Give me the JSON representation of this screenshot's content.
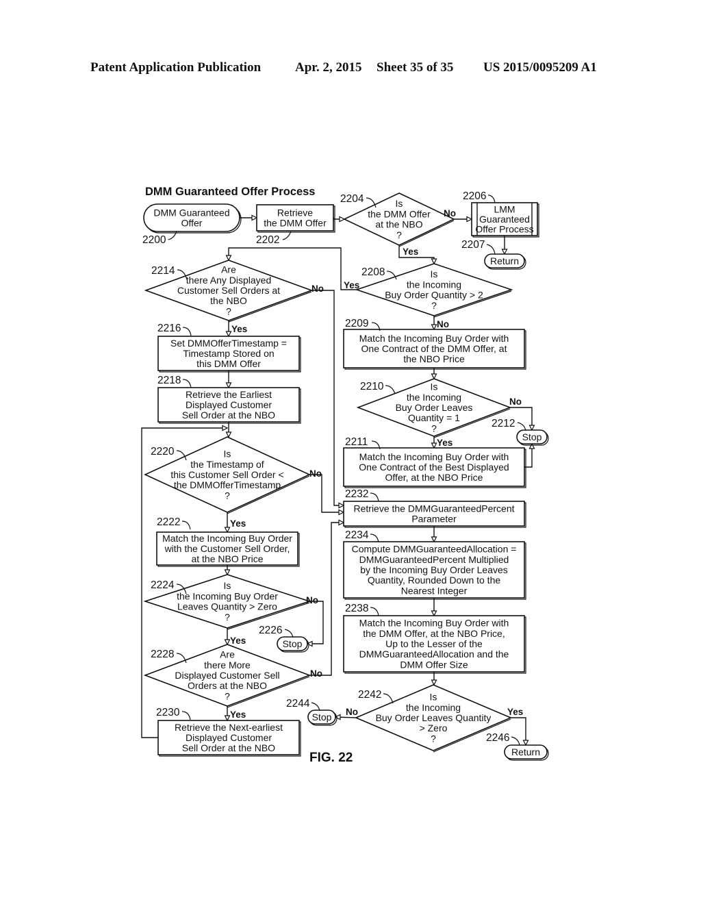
{
  "header": {
    "publication": "Patent Application Publication",
    "date": "Apr. 2, 2015",
    "sheet": "Sheet 35 of 35",
    "number": "US 2015/0095209 A1"
  },
  "diagram": {
    "title": "DMM Guaranteed Offer Process",
    "figure_label": "FIG. 22",
    "nodes": {
      "n2200": {
        "ref": "2200",
        "type": "terminal",
        "lines": [
          "DMM Guaranteed",
          "Offer"
        ]
      },
      "n2202": {
        "ref": "2202",
        "type": "process",
        "lines": [
          "Retrieve",
          "the DMM Offer"
        ]
      },
      "n2204": {
        "ref": "2204",
        "type": "decision",
        "lines": [
          "Is",
          "the DMM Offer",
          "at the NBO",
          "?"
        ]
      },
      "n2206": {
        "ref": "2206",
        "type": "predefined-process",
        "lines": [
          "LMM",
          "Guaranteed",
          "Offer Process"
        ]
      },
      "n2207": {
        "ref": "2207",
        "type": "terminal",
        "lines": [
          "Return"
        ]
      },
      "n2208": {
        "ref": "2208",
        "type": "decision",
        "lines": [
          "Is",
          "the Incoming",
          "Buy Order Quantity > 2",
          "?"
        ]
      },
      "n2209": {
        "ref": "2209",
        "type": "process",
        "lines": [
          "Match the Incoming Buy Order with",
          "One Contract of the DMM Offer, at",
          "the NBO Price"
        ]
      },
      "n2210": {
        "ref": "2210",
        "type": "decision",
        "lines": [
          "Is",
          "the Incoming",
          "Buy Order Leaves",
          "Quantity = 1",
          "?"
        ]
      },
      "n2211": {
        "ref": "2211",
        "type": "process",
        "lines": [
          "Match the Incoming Buy Order with",
          "One Contract of the Best Displayed",
          "Offer, at the NBO Price"
        ]
      },
      "n2212": {
        "ref": "2212",
        "type": "terminal",
        "lines": [
          "Stop"
        ]
      },
      "n2214": {
        "ref": "2214",
        "type": "decision",
        "lines": [
          "Are",
          "there Any Displayed",
          "Customer Sell Orders at",
          "the NBO",
          "?"
        ]
      },
      "n2216": {
        "ref": "2216",
        "type": "process",
        "lines": [
          "Set DMMOfferTimestamp =",
          "Timestamp Stored on",
          "this DMM Offer"
        ]
      },
      "n2218": {
        "ref": "2218",
        "type": "process",
        "lines": [
          "Retrieve the Earliest",
          "Displayed Customer",
          "Sell Order at the NBO"
        ]
      },
      "n2220": {
        "ref": "2220",
        "type": "decision",
        "lines": [
          "Is",
          "the Timestamp of",
          "this Customer Sell Order <",
          "the DMMOfferTimestamp",
          "?"
        ]
      },
      "n2222": {
        "ref": "2222",
        "type": "process",
        "lines": [
          "Match the Incoming Buy Order",
          "with the Customer Sell Order,",
          "at the NBO Price"
        ]
      },
      "n2224": {
        "ref": "2224",
        "type": "decision",
        "lines": [
          "Is",
          "the Incoming Buy Order",
          "Leaves Quantity > Zero",
          "?"
        ]
      },
      "n2226": {
        "ref": "2226",
        "type": "terminal",
        "lines": [
          "Stop"
        ]
      },
      "n2228": {
        "ref": "2228",
        "type": "decision",
        "lines": [
          "Are",
          "there More",
          "Displayed Customer Sell",
          "Orders at the NBO",
          "?"
        ]
      },
      "n2230": {
        "ref": "2230",
        "type": "process",
        "lines": [
          "Retrieve the Next-earliest",
          "Displayed Customer",
          "Sell Order at the NBO"
        ]
      },
      "n2232": {
        "ref": "2232",
        "type": "process",
        "lines": [
          "Retrieve the DMMGuaranteedPercent",
          "Parameter"
        ]
      },
      "n2234": {
        "ref": "2234",
        "type": "process",
        "lines": [
          "Compute DMMGuaranteedAllocation =",
          "DMMGuaranteedPercent Multiplied",
          "by the Incoming Buy Order Leaves",
          "Quantity, Rounded Down to the",
          "Nearest Integer"
        ]
      },
      "n2238": {
        "ref": "2238",
        "type": "process",
        "lines": [
          "Match the Incoming Buy Order with",
          "the DMM Offer, at the NBO Price,",
          "Up to the Lesser of the",
          "DMMGuaranteedAllocation and the",
          "DMM Offer Size"
        ]
      },
      "n2242": {
        "ref": "2242",
        "type": "decision",
        "lines": [
          "Is",
          "the Incoming",
          "Buy Order Leaves Quantity",
          "> Zero",
          "?"
        ]
      },
      "n2244": {
        "ref": "2244",
        "type": "terminal",
        "lines": [
          "Stop"
        ]
      },
      "n2246": {
        "ref": "2246",
        "type": "terminal",
        "lines": [
          "Return"
        ]
      }
    },
    "edge_labels": {
      "yes": "Yes",
      "no": "No"
    },
    "edges": [
      {
        "from": "2200",
        "to": "2202",
        "label": ""
      },
      {
        "from": "2202",
        "to": "2204",
        "label": ""
      },
      {
        "from": "2204",
        "to": "2206",
        "label": "No"
      },
      {
        "from": "2206",
        "to": "2207",
        "label": ""
      },
      {
        "from": "2204",
        "to": "2208",
        "label": "Yes"
      },
      {
        "from": "2208",
        "to": "2214",
        "label": "Yes"
      },
      {
        "from": "2208",
        "to": "2209",
        "label": "No"
      },
      {
        "from": "2209",
        "to": "2210",
        "label": ""
      },
      {
        "from": "2210",
        "to": "2212",
        "label": "No"
      },
      {
        "from": "2210",
        "to": "2211",
        "label": "Yes"
      },
      {
        "from": "2211",
        "to": "2212",
        "label": ""
      },
      {
        "from": "2214",
        "to": "2232",
        "label": "No"
      },
      {
        "from": "2214",
        "to": "2216",
        "label": "Yes"
      },
      {
        "from": "2216",
        "to": "2218",
        "label": ""
      },
      {
        "from": "2218",
        "to": "2220",
        "label": ""
      },
      {
        "from": "2220",
        "to": "2232",
        "label": "No"
      },
      {
        "from": "2220",
        "to": "2222",
        "label": "Yes"
      },
      {
        "from": "2222",
        "to": "2224",
        "label": ""
      },
      {
        "from": "2224",
        "to": "2226",
        "label": "No"
      },
      {
        "from": "2224",
        "to": "2228",
        "label": "Yes"
      },
      {
        "from": "2228",
        "to": "2232",
        "label": "No"
      },
      {
        "from": "2228",
        "to": "2230",
        "label": "Yes"
      },
      {
        "from": "2230",
        "to": "2220",
        "label": ""
      },
      {
        "from": "2232",
        "to": "2234",
        "label": ""
      },
      {
        "from": "2234",
        "to": "2238",
        "label": ""
      },
      {
        "from": "2238",
        "to": "2242",
        "label": ""
      },
      {
        "from": "2242",
        "to": "2244",
        "label": "No"
      },
      {
        "from": "2242",
        "to": "2246",
        "label": "Yes"
      }
    ]
  }
}
